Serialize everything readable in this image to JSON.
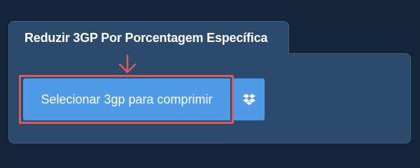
{
  "panel": {
    "title": "Reduzir 3GP Por Porcentagem Específica"
  },
  "upload": {
    "select_label": "Selecionar 3gp para comprimir",
    "dropbox_icon": "dropbox-icon"
  },
  "colors": {
    "page_background": "#14243a",
    "panel_background": "#2c4a6b",
    "button_blue": "#4f9be8",
    "highlight_red": "#d95c5c"
  }
}
